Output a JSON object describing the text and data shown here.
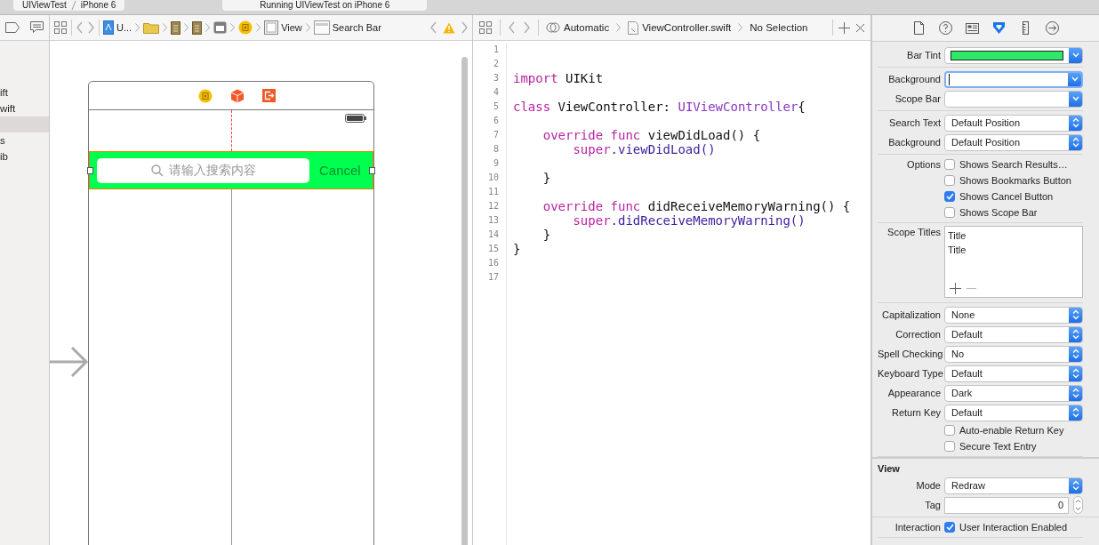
{
  "toolbar": {
    "scheme": "UIViewTest",
    "device": "iPhone 6",
    "status": "Running UIViewTest on iPhone 6"
  },
  "navigator": {
    "items": [
      {
        "label": "ift",
        "selected": false
      },
      {
        "label": "wift",
        "selected": false
      },
      {
        "selected": true
      },
      {
        "label": "s",
        "selected": false
      },
      {
        "label": "ib",
        "selected": false
      }
    ]
  },
  "storyboard": {
    "jump_bar": [
      {
        "kind": "project",
        "label": "U..."
      },
      {
        "kind": "folder"
      },
      {
        "kind": "doc"
      },
      {
        "kind": "doc"
      },
      {
        "kind": "scene"
      },
      {
        "kind": "controller"
      },
      {
        "kind": "view",
        "label": "View"
      },
      {
        "kind": "searchbar",
        "label": "Search Bar"
      }
    ],
    "search_bar": {
      "selected": true,
      "color": "#00ff4e",
      "placeholder": "请输入搜索内容",
      "cancel": "Cancel"
    }
  },
  "editor": {
    "jump_bar": [
      {
        "kind": "assistant",
        "label": "Automatic"
      },
      {
        "kind": "file",
        "label": "ViewController.swift"
      },
      {
        "kind": "plain",
        "label": "No Selection"
      }
    ],
    "lines": [
      {
        "number": "1"
      },
      {
        "number": "2"
      },
      {
        "number": "3",
        "tokens": [
          {
            "kind": "keyword",
            "text": "import"
          },
          {
            "kind": "plain",
            "text": " UIKit"
          }
        ]
      },
      {
        "number": "4"
      },
      {
        "number": "5",
        "tokens": [
          {
            "kind": "keyword",
            "text": "class"
          },
          {
            "kind": "plain",
            "text": " ViewController: "
          },
          {
            "kind": "type",
            "text": "UIViewController"
          },
          {
            "kind": "plain",
            "text": "{"
          }
        ]
      },
      {
        "number": "6"
      },
      {
        "number": "7",
        "tokens": [
          {
            "kind": "keyword",
            "text": "    override func"
          },
          {
            "kind": "plain",
            "text": " viewDidLoad() {"
          }
        ]
      },
      {
        "number": "8",
        "tokens": [
          {
            "kind": "keyword",
            "text": "        super"
          },
          {
            "kind": "method",
            "text": ".viewDidLoad()"
          }
        ]
      },
      {
        "number": "9"
      },
      {
        "number": "10",
        "tokens": [
          {
            "kind": "plain",
            "text": "    }"
          }
        ]
      },
      {
        "number": "11"
      },
      {
        "number": "12",
        "tokens": [
          {
            "kind": "keyword",
            "text": "    override func"
          },
          {
            "kind": "plain",
            "text": " didReceiveMemoryWarning() {"
          }
        ]
      },
      {
        "number": "13",
        "tokens": [
          {
            "kind": "keyword",
            "text": "        super"
          },
          {
            "kind": "method",
            "text": ".didReceiveMemoryWarning()"
          }
        ]
      },
      {
        "number": "14",
        "tokens": [
          {
            "kind": "plain",
            "text": "    }"
          }
        ]
      },
      {
        "number": "15",
        "tokens": [
          {
            "kind": "plain",
            "text": "}"
          }
        ]
      },
      {
        "number": "16"
      },
      {
        "number": "17"
      }
    ]
  },
  "inspector": {
    "tabs": [
      {
        "kind": "file",
        "selected": false
      },
      {
        "kind": "help",
        "selected": false
      },
      {
        "kind": "identity",
        "selected": false
      },
      {
        "kind": "attributes",
        "selected": true
      },
      {
        "kind": "size",
        "selected": false
      },
      {
        "kind": "connections",
        "selected": false
      }
    ],
    "sections": [
      {
        "rows": [
          {
            "kind": "color",
            "label": "Bar Tint",
            "color": "#2ee86a",
            "focused": false
          }
        ]
      },
      {
        "rows": [
          {
            "kind": "color",
            "label": "Background",
            "focused": true
          },
          {
            "kind": "color",
            "label": "Scope Bar",
            "focused": false
          }
        ]
      },
      {
        "rows": [
          {
            "kind": "select",
            "label": "Search Text",
            "value": "Default Position"
          },
          {
            "kind": "select",
            "label": "Background",
            "value": "Default Position"
          }
        ]
      },
      {
        "rows": [
          {
            "kind": "check",
            "label": "Options",
            "text": "Shows Search Results…",
            "checked": false
          },
          {
            "kind": "check",
            "text": "Shows Bookmarks Button",
            "checked": false
          },
          {
            "kind": "check",
            "text": "Shows Cancel Button",
            "checked": true
          },
          {
            "kind": "check",
            "text": "Shows Scope Bar",
            "checked": false
          }
        ]
      },
      {
        "rows": [
          {
            "kind": "list",
            "label": "Scope Titles",
            "items": [
              "Title",
              "Title"
            ]
          }
        ]
      },
      {
        "rows": [
          {
            "kind": "select",
            "label": "Capitalization",
            "value": "None"
          },
          {
            "kind": "select",
            "label": "Correction",
            "value": "Default"
          },
          {
            "kind": "select",
            "label": "Spell Checking",
            "value": "No"
          },
          {
            "kind": "select",
            "label": "Keyboard Type",
            "value": "Default"
          },
          {
            "kind": "select",
            "label": "Appearance",
            "value": "Dark"
          },
          {
            "kind": "select",
            "label": "Return Key",
            "value": "Default"
          },
          {
            "kind": "check",
            "text": "Auto-enable Return Key",
            "checked": false
          },
          {
            "kind": "check",
            "text": "Secure Text Entry",
            "checked": false
          }
        ]
      },
      {
        "title": "View",
        "rows": [
          {
            "kind": "select",
            "label": "Mode",
            "value": "Redraw"
          },
          {
            "kind": "stepper",
            "label": "Tag",
            "value": "0"
          }
        ]
      },
      {
        "rows": [
          {
            "kind": "check",
            "label": "Interaction",
            "text": "User Interaction Enabled",
            "checked": true
          }
        ]
      }
    ]
  }
}
